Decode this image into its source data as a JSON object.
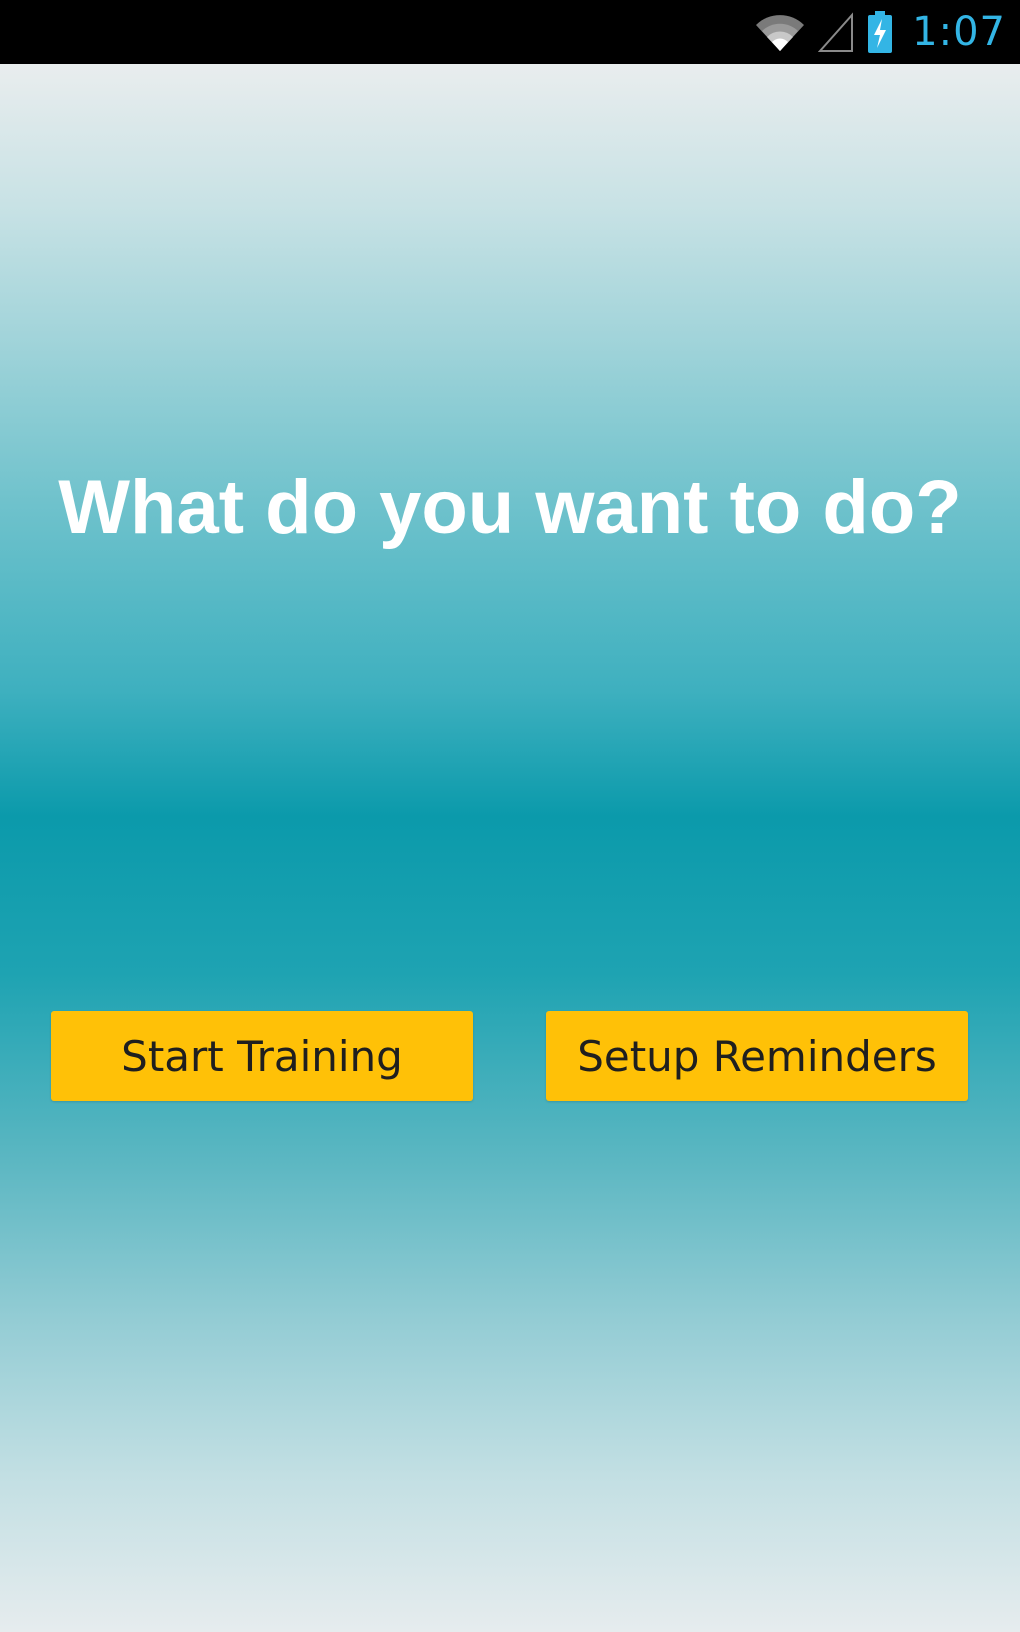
{
  "status_bar": {
    "time": "1:07",
    "clock_color": "#33b5e5",
    "icons": [
      "wifi-icon",
      "cell-signal-icon",
      "battery-charging-icon"
    ]
  },
  "main": {
    "question": "What do you want to do?",
    "start_training_label": "Start Training",
    "setup_reminders_label": "Setup Reminders"
  },
  "colors": {
    "button_bg": "#ffc107",
    "gradient_center": "#0b9aab",
    "gradient_edge": "#e9edee"
  }
}
